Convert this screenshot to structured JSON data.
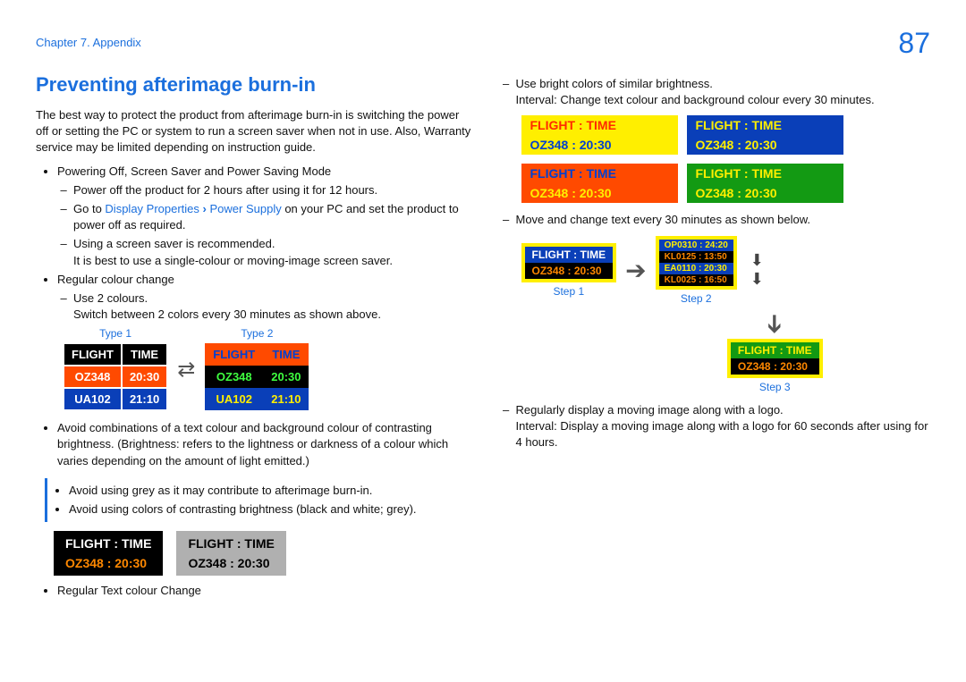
{
  "header": {
    "chapter": "Chapter 7. Appendix",
    "page": "87"
  },
  "title": "Preventing afterimage burn-in",
  "intro": "The best way to protect the product from afterimage burn-in is switching the power off or setting the PC or system to run a screen saver when not in use. Also, Warranty service may be limited depending on instruction guide.",
  "left": {
    "b1": "Powering Off, Screen Saver and Power Saving Mode",
    "b1a": "Power off the product for 2 hours after using it for 12 hours.",
    "b1b_pre": "Go to ",
    "b1b_link1": "Display Properties",
    "b1b_link2": "Power Supply",
    "b1b_post": " on your PC and set the product to power off as required.",
    "b1c": "Using a screen saver is recommended.",
    "b1c_note": "It is best to use a single-colour or moving-image screen saver.",
    "b2": "Regular colour change",
    "b2a": "Use 2 colours.",
    "b2a_note": "Switch between 2 colors every 30 minutes as shown above.",
    "type1_label": "Type 1",
    "type2_label": "Type 2",
    "tbl": {
      "h1": "FLIGHT",
      "h2": "TIME",
      "r2a": "OZ348",
      "r2b": "20:30",
      "r3a": "UA102",
      "r3b": "21:10"
    },
    "b3": "Avoid combinations of a text colour and background colour of contrasting brightness. (Brightness: refers to the lightness or darkness of a colour which varies depending on the amount of light emitted.)",
    "callout1": "Avoid using grey as it may contribute to afterimage burn-in.",
    "callout2": "Avoid using colors of contrasting brightness (black and white; grey).",
    "panel_l1": "FLIGHT   :   TIME",
    "panel_l2": "OZ348    :   20:30",
    "b4": "Regular Text colour Change"
  },
  "right": {
    "b1": "Use bright colors of similar brightness.",
    "b1_note": "Interval: Change text colour and background colour every 30 minutes.",
    "panel_l1": "FLIGHT   :   TIME",
    "panel_l2": "OZ348    :   20:30",
    "b2": "Move and change text every 30 minutes as shown below.",
    "sp1_l1": "FLIGHT    :   TIME",
    "sp1_l2": "OZ348    :   20:30",
    "sp2_l1": "OP0310   :  24:20",
    "sp2_l2": "KL0125   :  13:50",
    "sp2_l3": "EA0110   :  20:30",
    "sp2_l4": "KL0025   :  16:50",
    "step1": "Step 1",
    "step2": "Step 2",
    "step3": "Step 3",
    "sp3_l1": "FLIGHT    :   TIME",
    "sp3_l2": "OZ348    :   20:30",
    "b3": "Regularly display a moving image along with a logo.",
    "b3_note": "Interval: Display a moving image along with a logo for 60 seconds after using for 4 hours."
  }
}
